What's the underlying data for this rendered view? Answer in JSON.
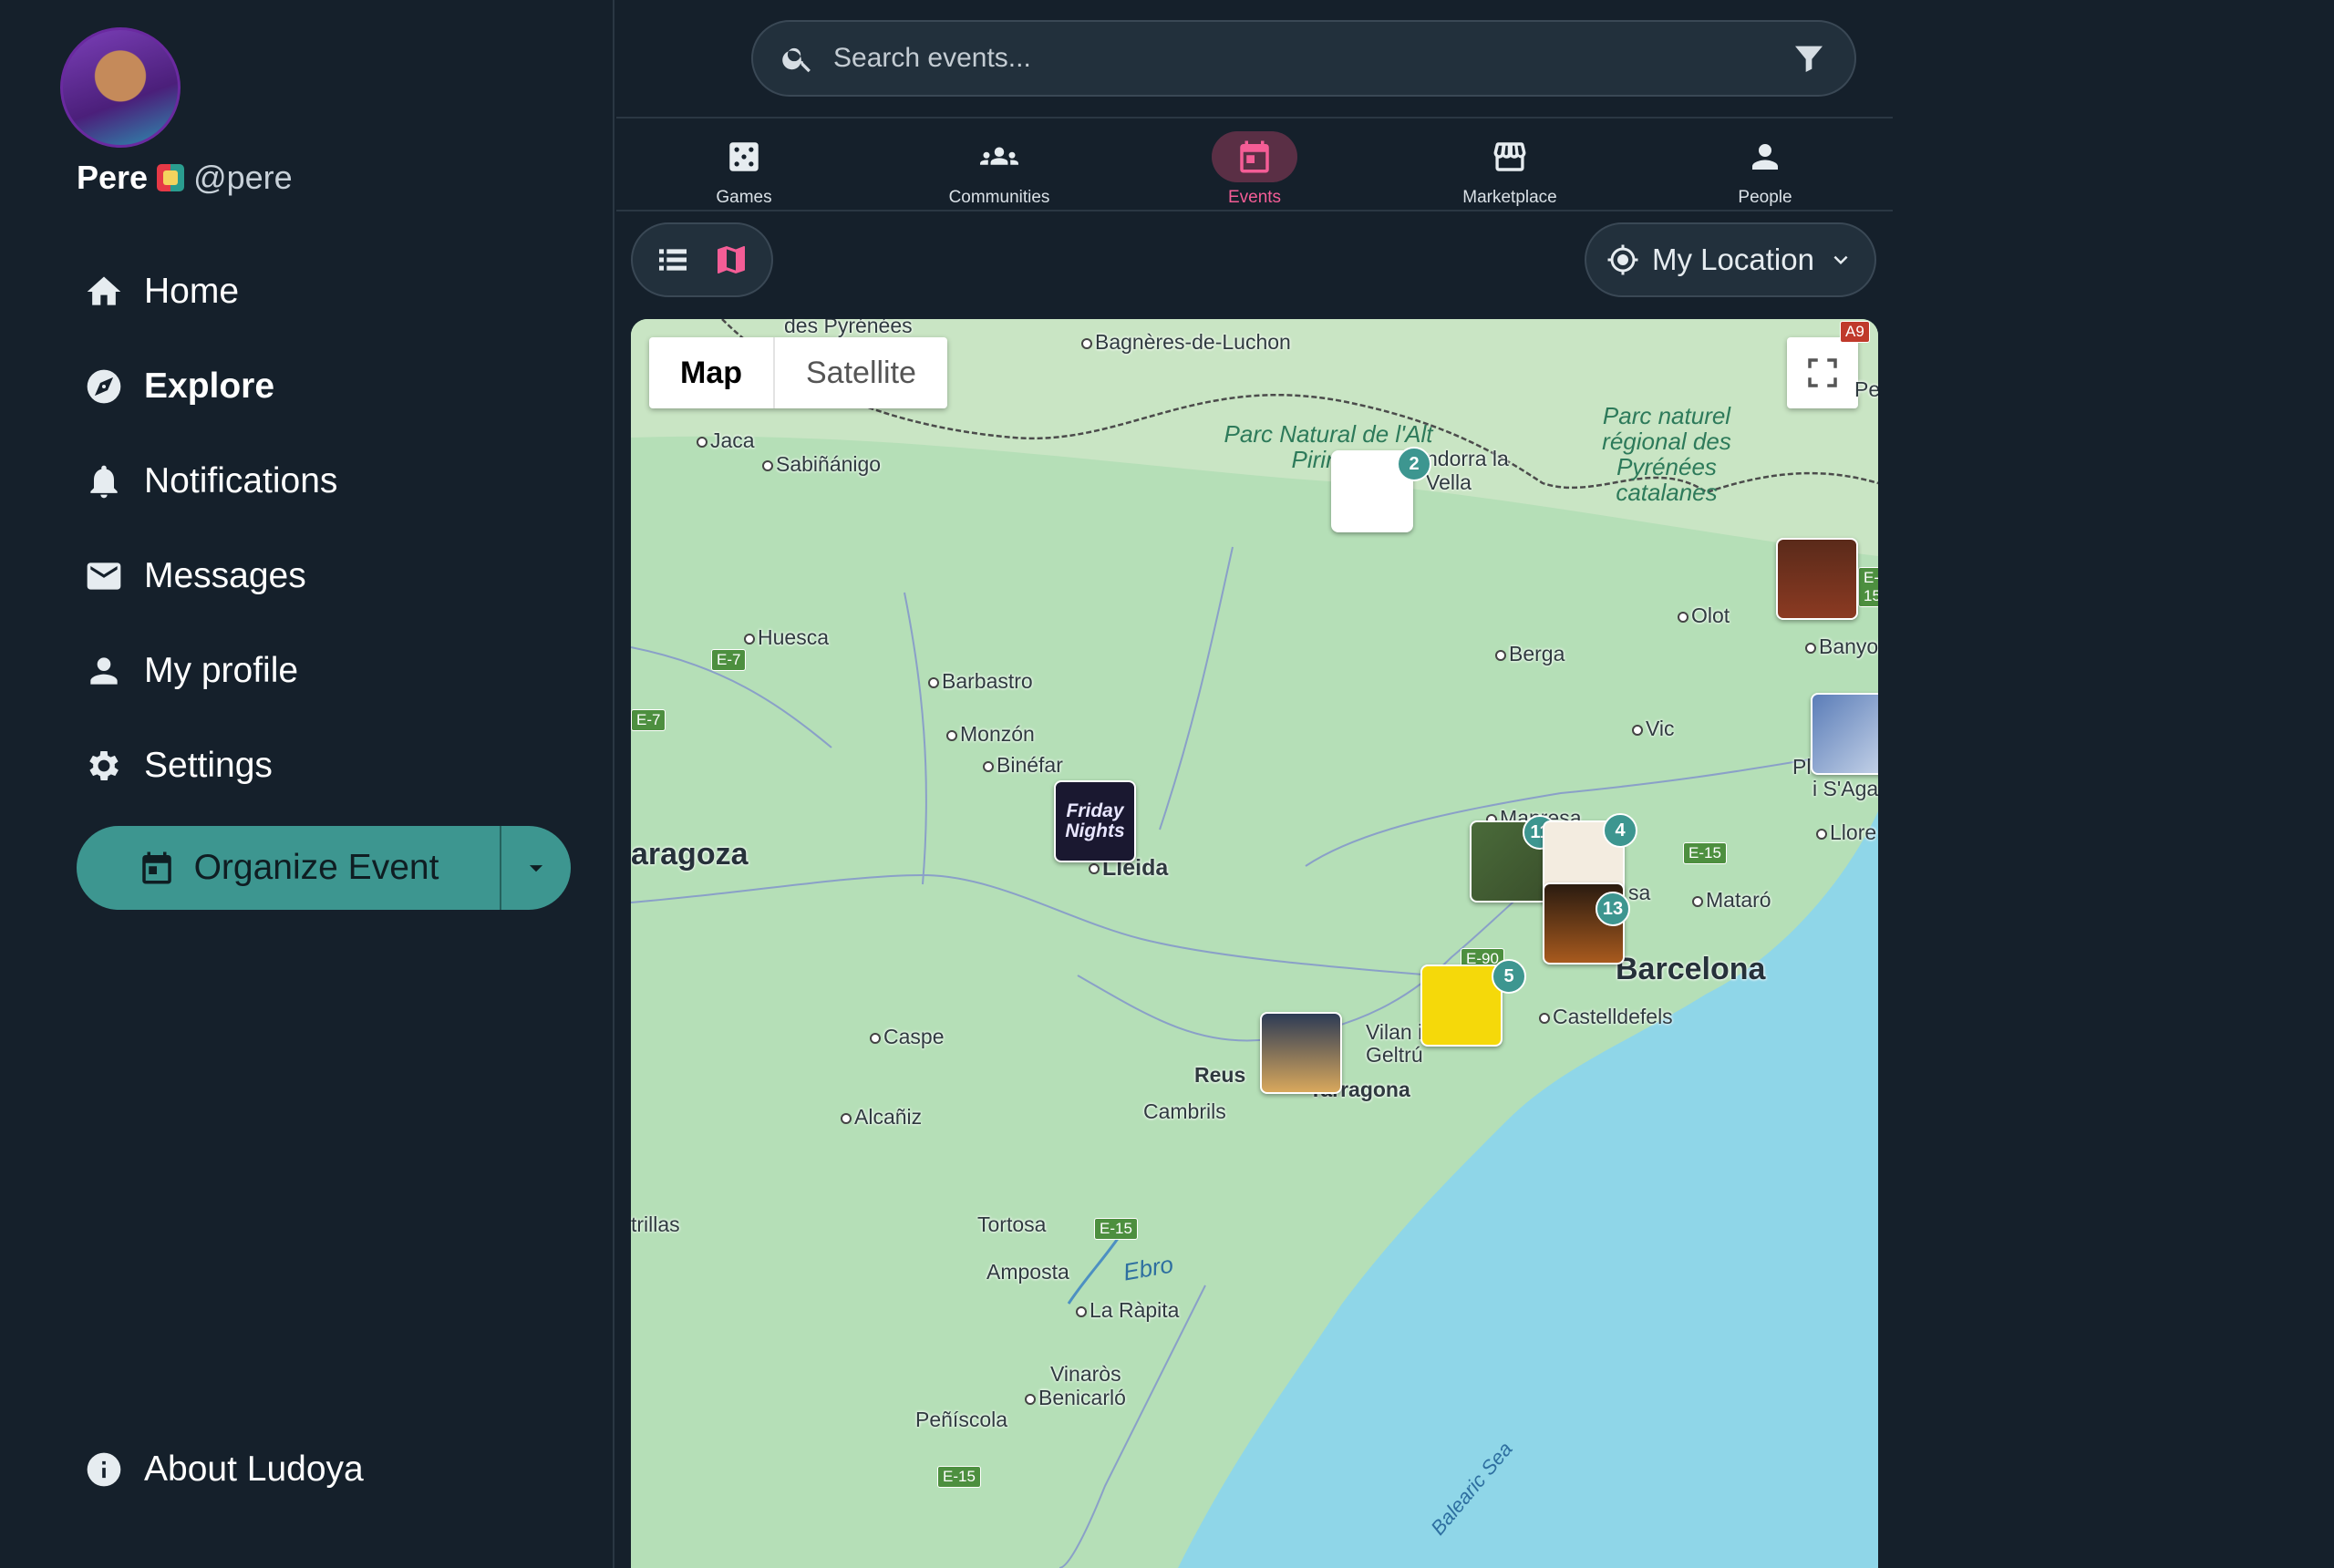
{
  "user": {
    "name": "Pere",
    "handle": "@pere"
  },
  "sidebar": {
    "items": [
      {
        "label": "Home",
        "icon": "home-icon"
      },
      {
        "label": "Explore",
        "icon": "compass-icon",
        "active": true
      },
      {
        "label": "Notifications",
        "icon": "bell-icon"
      },
      {
        "label": "Messages",
        "icon": "envelope-icon"
      },
      {
        "label": "My profile",
        "icon": "person-icon"
      },
      {
        "label": "Settings",
        "icon": "gear-icon"
      }
    ],
    "organize_label": "Organize Event",
    "about_label": "About Ludoya"
  },
  "search": {
    "placeholder": "Search events..."
  },
  "tabs": [
    {
      "label": "Games",
      "icon": "dice-icon"
    },
    {
      "label": "Communities",
      "icon": "group-icon"
    },
    {
      "label": "Events",
      "icon": "calendar-icon",
      "active": true
    },
    {
      "label": "Marketplace",
      "icon": "store-icon"
    },
    {
      "label": "People",
      "icon": "person-icon"
    }
  ],
  "location": {
    "label": "My Location"
  },
  "map": {
    "map_label": "Map",
    "satellite_label": "Satellite",
    "places": {
      "pyrenees": "des Pyrénées",
      "bagneres": "Bagnères-de-Luchon",
      "jaca": "Jaca",
      "sabinanigo": "Sabiñánigo",
      "huesca": "Huesca",
      "barbastro": "Barbastro",
      "monzon": "Monzón",
      "binefar": "Binéfar",
      "zaragoza": "aragoza",
      "lleida": "Lleida",
      "caspe": "Caspe",
      "alcaniz": "Alcañiz",
      "trillas": "trillas",
      "tortosa": "Tortosa",
      "amposta": "Amposta",
      "larapita": "La Ràpita",
      "vinaros": "Vinaròs",
      "benicarlo": "Benicarló",
      "peniscola": "Peñíscola",
      "reus": "Reus",
      "cambrils": "Cambrils",
      "tarragona": "Tarragona",
      "vilanova": "Vilan i la Geltrú",
      "castelldefels": "Castelldefels",
      "barcelona": "Barcelona",
      "mataro": "Mataró",
      "sabadell": "sa",
      "manresa": "Manresa",
      "vic": "Vic",
      "berga": "Berga",
      "olot": "Olot",
      "banyoles": "Banyol",
      "lloret": "Llore",
      "sagaro": "i S'Aga",
      "pl": "Pl",
      "andorra": "ndorra la Vella",
      "pe": "Pe"
    },
    "parks": {
      "altpirineu": "Parc Natural de l'Alt Pirineu",
      "pyrenees_catalanes": "Parc naturel régional des Pyrénées catalanes"
    },
    "water": {
      "ebro": "Ebro",
      "sea": "Balearic Sea"
    },
    "roads": [
      "E-7",
      "E-7",
      "E-15",
      "E-15",
      "E-15",
      "E-90",
      "A9",
      "E-15"
    ],
    "markers": {
      "friday_text": "Friday Nights",
      "counts": [
        "2",
        "11",
        "4",
        "13",
        "5"
      ]
    }
  }
}
